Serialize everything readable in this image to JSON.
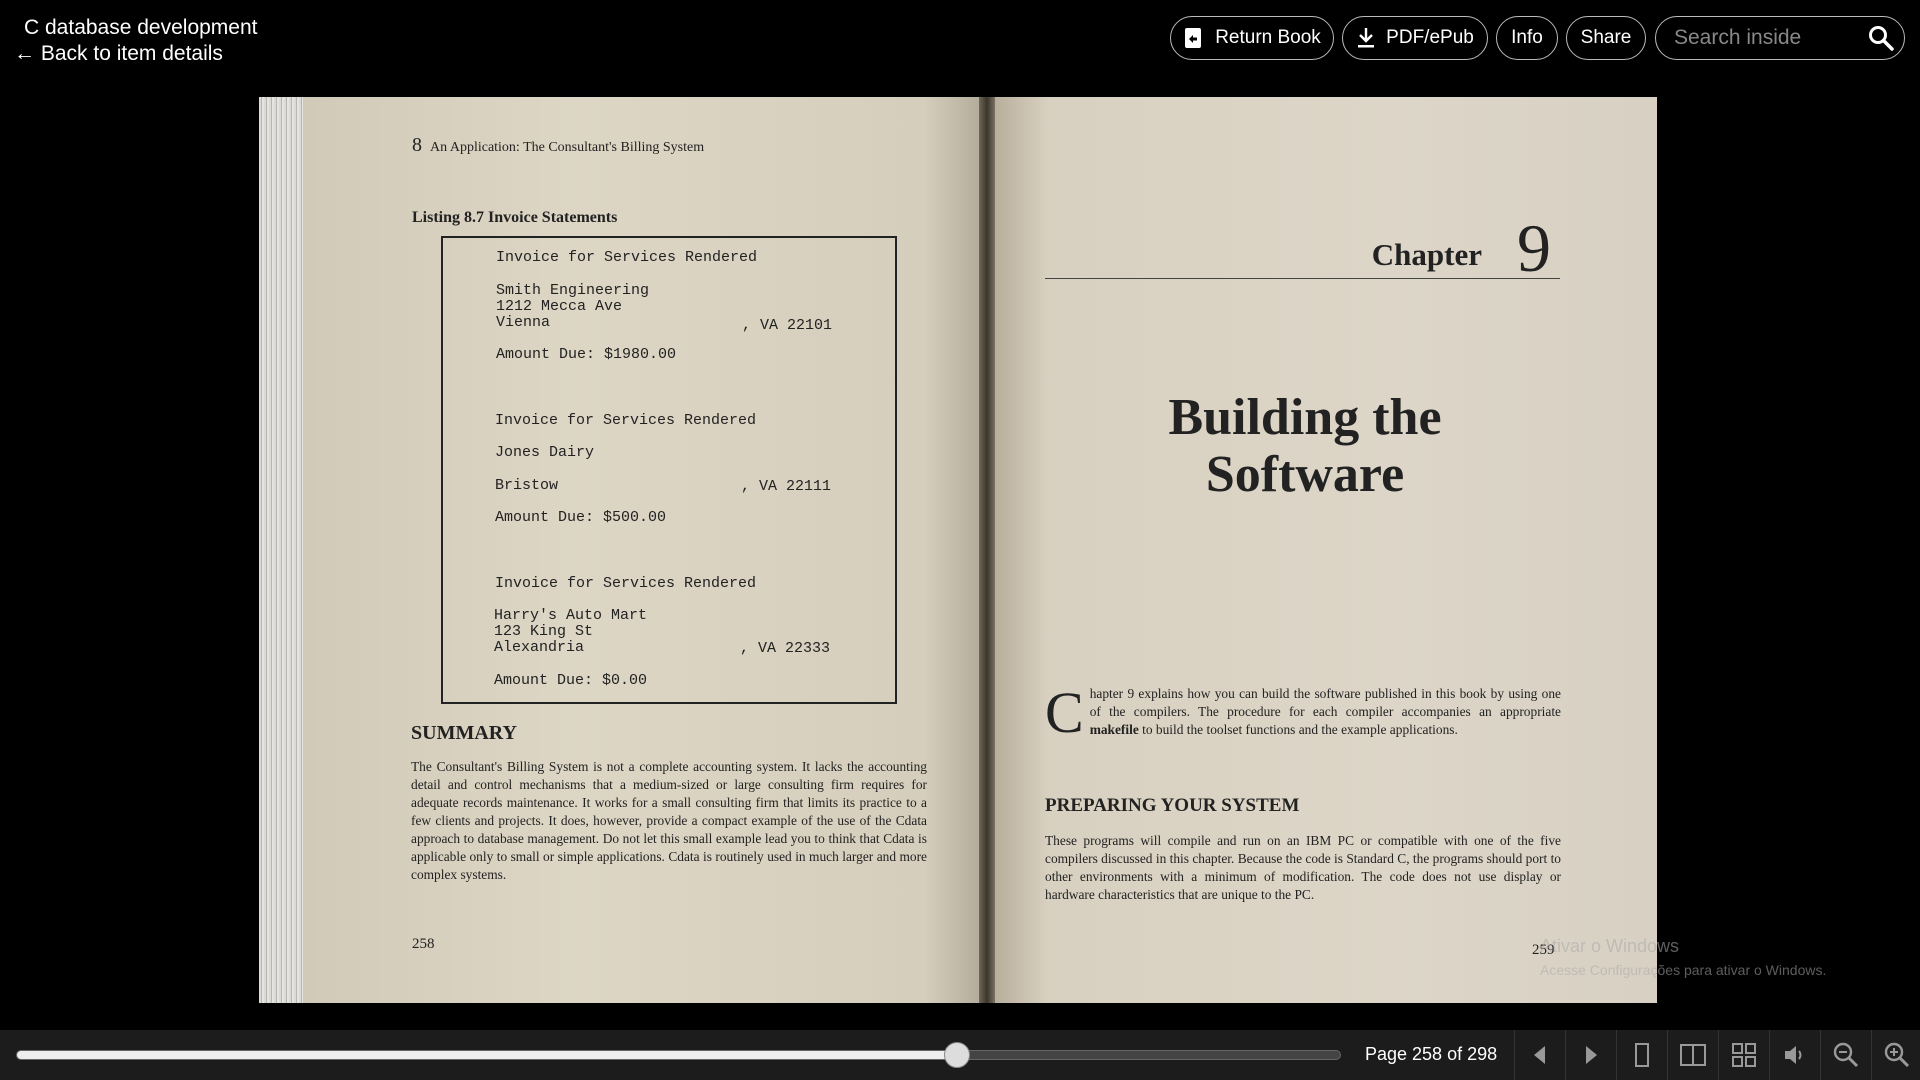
{
  "header": {
    "title": "C database development",
    "back_link": "← Back to item details",
    "buttons": {
      "return_book": "Return Book",
      "pdf_epub": "PDF/ePub",
      "info": "Info",
      "share": "Share"
    },
    "search_placeholder": "Search inside"
  },
  "left_page": {
    "running_head_number": "8",
    "running_head_text": "An Application: The Consultant's Billing System",
    "listing_title": "Listing 8.7 Invoice Statements",
    "invoices": [
      {
        "heading": "Invoice for Services Rendered",
        "name": "Smith Engineering",
        "street": "1212 Mecca Ave",
        "city": "Vienna",
        "state_zip": ", VA 22101",
        "amount": "Amount Due: $1980.00"
      },
      {
        "heading": "Invoice for Services Rendered",
        "name": "Jones Dairy",
        "street": "",
        "city": "Bristow",
        "state_zip": ", VA 22111",
        "amount": "Amount Due: $500.00"
      },
      {
        "heading": "Invoice for Services Rendered",
        "name": "Harry's Auto Mart",
        "street": "123 King St",
        "city": "Alexandria",
        "state_zip": ", VA 22333",
        "amount": "Amount Due: $0.00"
      }
    ],
    "summary_heading": "SUMMARY",
    "summary_text": "The Consultant's Billing System is not a complete accounting system. It lacks the accounting detail and control mechanisms that a medium-sized or large consulting firm requires for adequate records maintenance. It works for a small consulting firm that limits its practice to a few clients and projects. It does, however, provide a compact example of the use of the Cdata approach to database management. Do not let this small example lead you to think that Cdata is applicable only to small or simple applications. Cdata is routinely used in much larger and more complex systems.",
    "page_number": "258"
  },
  "right_page": {
    "chapter_word": "Chapter",
    "chapter_number": "9",
    "title_line1": "Building the",
    "title_line2": "Software",
    "intro_dropcap": "C",
    "intro_before_bold": "hapter 9 explains how you can build the software published in this book by using one of the compilers. The procedure for each compiler accompanies an appropriate ",
    "intro_bold": "makefile",
    "intro_after_bold": " to build the toolset functions and the example applications.",
    "section_heading": "PREPARING YOUR SYSTEM",
    "section_text": "These programs will compile and run on an IBM PC or compatible with one of the five compilers discussed in this chapter. Because the code is Standard C, the programs should port to other environments with a minimum of modification. The code does not use display or hardware characteristics that are unique to the PC.",
    "page_number": "259"
  },
  "watermark": {
    "line1": "Ativar o Windows",
    "line2": "Acesse Configurações para ativar o Windows."
  },
  "footer": {
    "page_label": "Page 258 of 298",
    "current_page": 258,
    "total_pages": 298,
    "slider_fraction": 0.71,
    "controls": [
      "prev-page-icon",
      "next-page-icon",
      "one-page-view-icon",
      "two-page-view-icon",
      "thumbnail-view-icon",
      "read-aloud-icon",
      "zoom-out-icon",
      "zoom-in-icon"
    ]
  }
}
